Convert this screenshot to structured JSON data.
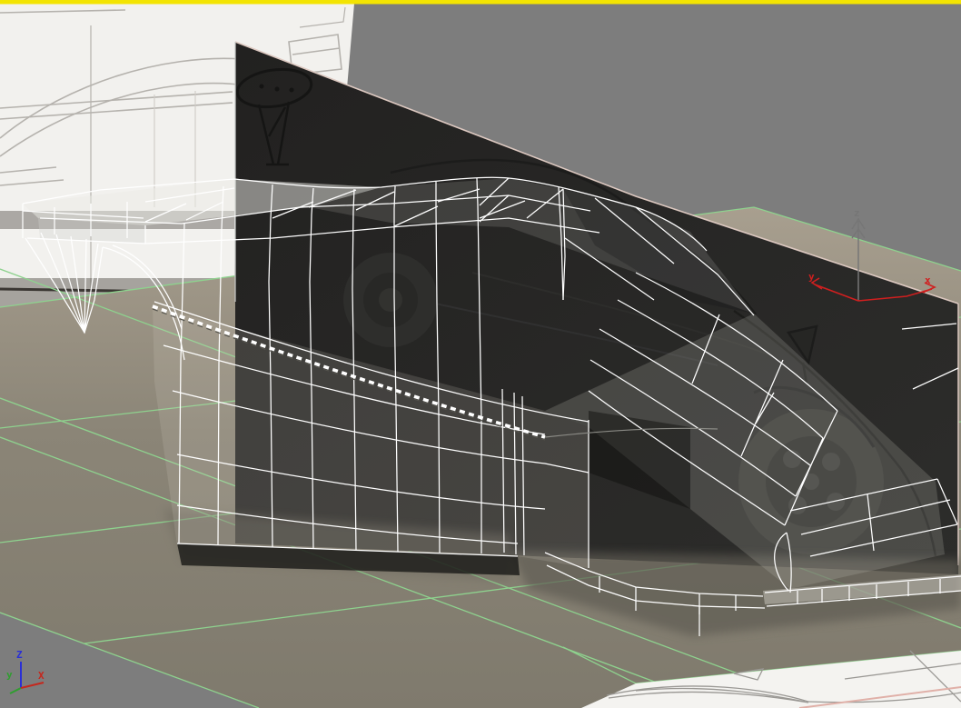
{
  "viewport": {
    "name": "perspective-viewport",
    "description": "3D modeling viewport showing a polygonal car body (wireframe) built over reference image planes",
    "active_border_color": "#f3e402",
    "background_color": "#7d7d7d"
  },
  "world_axis_tripod": {
    "x_label": "X",
    "y_label": "y",
    "z_label": "Z",
    "x_color": "#c5271d",
    "y_color": "#2f9e2f",
    "z_color": "#2a2fd6"
  },
  "transform_gizmo": {
    "x_label": "x",
    "y_label": "y",
    "z_label": "z",
    "xy_color": "#d01f1f",
    "z_color": "#767676"
  },
  "scene": {
    "ground_plane": {
      "name": "ground-plane",
      "fill_far": "#a89f8f",
      "fill_near": "#807b6e",
      "grid_color": "#8ed28e"
    },
    "side_reference_plane": {
      "name": "side-view-reference-plane",
      "fill": "#242423",
      "edge_color": "#dcc8c0"
    },
    "rear_reference_plane": {
      "name": "rear-view-reference-plane",
      "fill": "#f2f1ee",
      "sketch_color": "#b5b2ad"
    },
    "top_reference_plane": {
      "name": "top-view-reference-plane",
      "fill": "#f4f3f0",
      "sketch_color": "#9a9894",
      "edge_color": "#e0b0a8"
    },
    "car_mesh": {
      "name": "car-body-editable-poly",
      "wire_color": "#ffffff",
      "selected_edge_style": "dashed"
    }
  }
}
